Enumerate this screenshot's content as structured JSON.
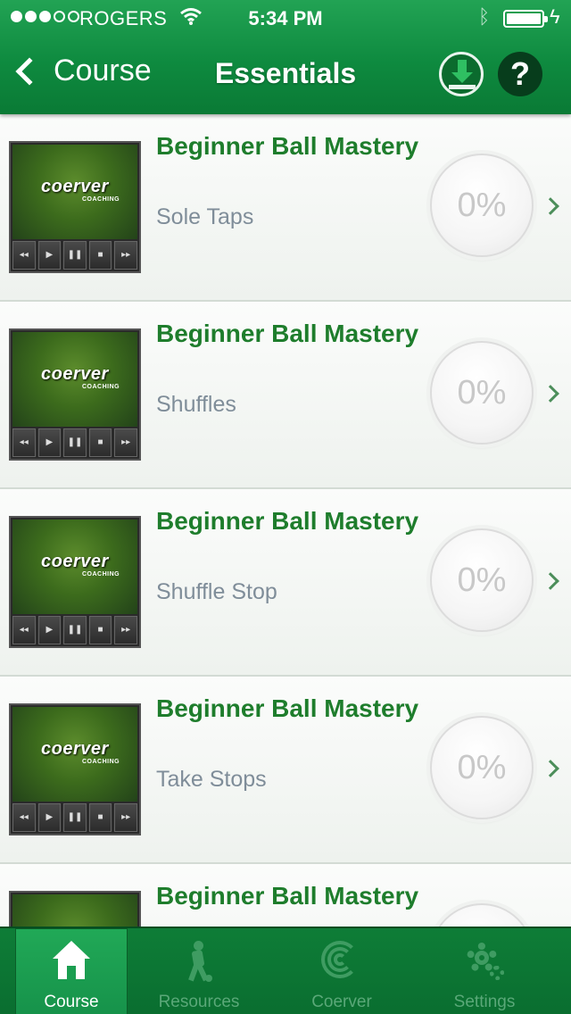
{
  "status_bar": {
    "carrier": "ROGERS",
    "time": "5:34 PM",
    "signal_bars": 3,
    "signal_total": 5,
    "battery_level": 1.0
  },
  "nav": {
    "back_label": "Course",
    "title": "Essentials",
    "download_icon": "download-icon",
    "help_glyph": "?"
  },
  "items": [
    {
      "title": "Beginner Ball Mastery",
      "subtitle": "Sole Taps",
      "progress": "0%",
      "thumb_logo": "coerver",
      "thumb_sub": "COACHING"
    },
    {
      "title": "Beginner Ball Mastery",
      "subtitle": "Shuffles",
      "progress": "0%",
      "thumb_logo": "coerver",
      "thumb_sub": "COACHING"
    },
    {
      "title": "Beginner Ball Mastery",
      "subtitle": "Shuffle Stop",
      "progress": "0%",
      "thumb_logo": "coerver",
      "thumb_sub": "COACHING"
    },
    {
      "title": "Beginner Ball Mastery",
      "subtitle": "Take Stops",
      "progress": "0%",
      "thumb_logo": "coerver",
      "thumb_sub": "COACHING"
    },
    {
      "title": "Beginner Ball Mastery",
      "subtitle": "",
      "progress": "",
      "thumb_logo": "",
      "thumb_sub": ""
    }
  ],
  "player_controls": [
    "◂◂",
    "▶",
    "❚❚",
    "■",
    "▸▸"
  ],
  "tabs": [
    {
      "label": "Course",
      "icon": "home-icon",
      "active": true
    },
    {
      "label": "Resources",
      "icon": "player-icon",
      "active": false
    },
    {
      "label": "Coerver",
      "icon": "coerver-logo-icon",
      "active": false
    },
    {
      "label": "Settings",
      "icon": "gear-icon",
      "active": false
    }
  ],
  "colors": {
    "header_green": "#0e8a3f",
    "title_green": "#1e7d2c",
    "subtitle_gray": "#7f8d99",
    "tabbar_green": "#0a6e30"
  }
}
